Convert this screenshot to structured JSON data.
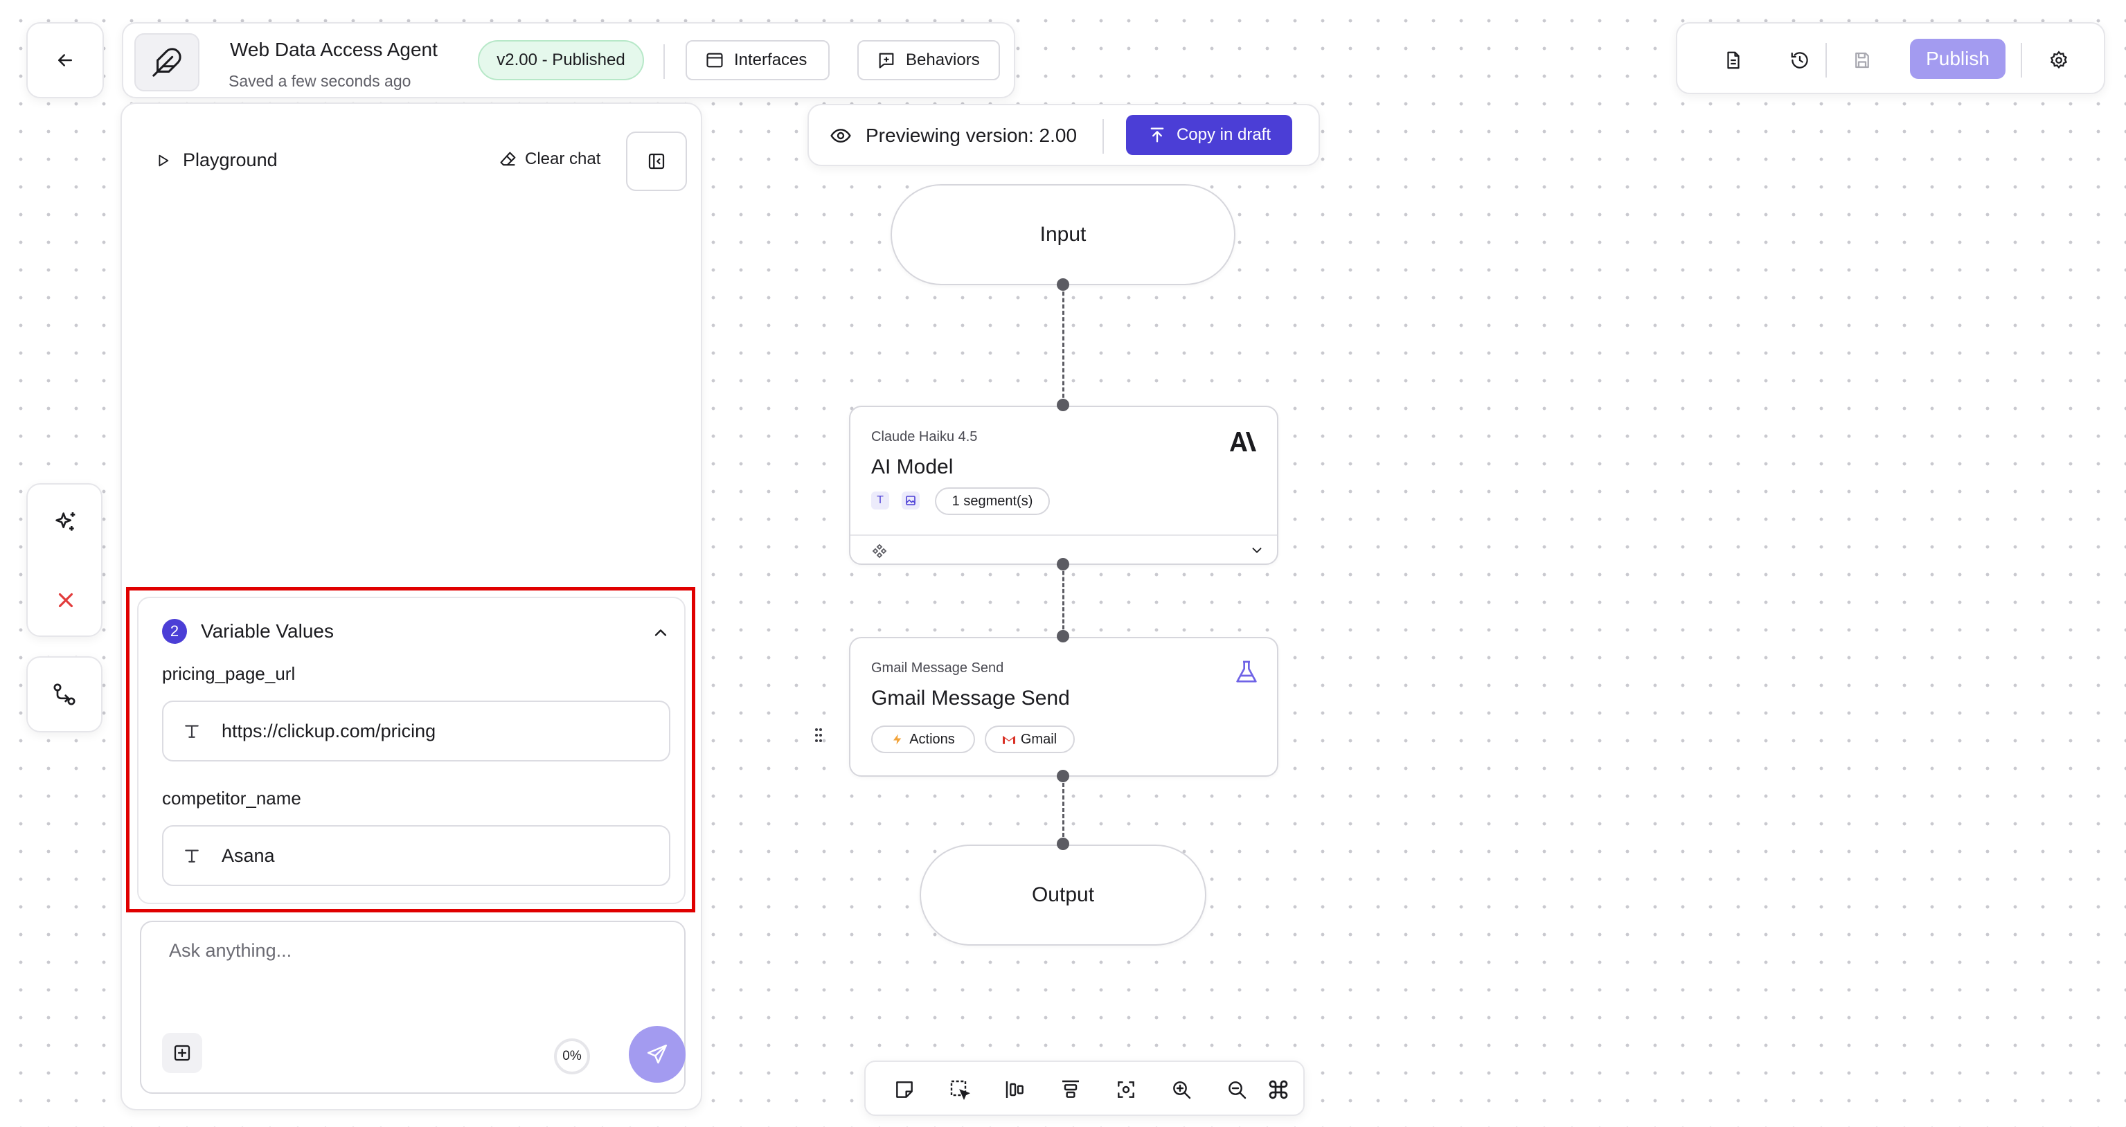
{
  "header": {
    "title": "Web Data Access Agent",
    "subtitle": "Saved a few seconds ago",
    "version_badge": "v2.00 - Published",
    "interfaces_label": "Interfaces",
    "behaviors_label": "Behaviors"
  },
  "toolbar": {
    "publish_label": "Publish"
  },
  "playground": {
    "title": "Playground",
    "clear_chat_label": "Clear chat"
  },
  "variables": {
    "count": "2",
    "title": "Variable Values",
    "items": [
      {
        "name": "pricing_page_url",
        "value": "https://clickup.com/pricing"
      },
      {
        "name": "competitor_name",
        "value": "Asana"
      }
    ]
  },
  "chat": {
    "placeholder": "Ask anything...",
    "usage": "0%"
  },
  "preview": {
    "text": "Previewing version:  2.00",
    "copy_label": "Copy in draft"
  },
  "flow": {
    "input_label": "Input",
    "output_label": "Output",
    "ai_node": {
      "kicker": "Claude Haiku 4.5",
      "title": "AI Model",
      "segments": "1 segment(s)"
    },
    "gmail_node": {
      "kicker": "Gmail Message Send",
      "title": "Gmail Message Send",
      "tag_actions": "Actions",
      "tag_gmail": "Gmail"
    }
  },
  "colors": {
    "accent": "#4b3ed6",
    "publish_disabled": "#a39bf0",
    "highlight_border": "#e00000",
    "published_badge_bg": "#e5f8ec"
  }
}
